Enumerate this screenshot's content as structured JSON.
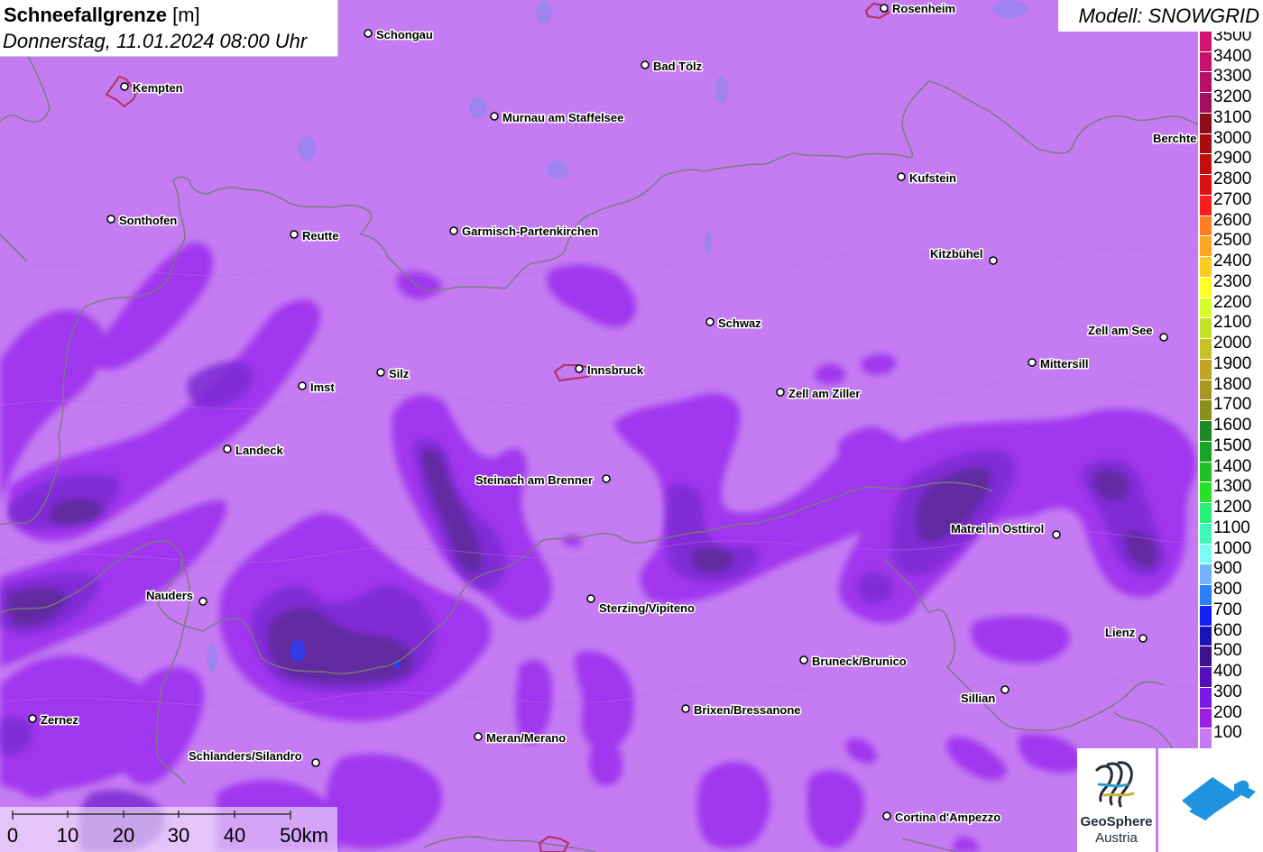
{
  "title": {
    "parameter": "Schneefallgrenze",
    "unit": "[m]",
    "datetime": "Donnerstag, 11.01.2024 08:00 Uhr"
  },
  "model_label": "Modell: SNOWGRID",
  "legend": {
    "unit": "m",
    "entries": [
      {
        "label": "3500",
        "color": "#d4156f"
      },
      {
        "label": "3400",
        "color": "#c8116a"
      },
      {
        "label": "3300",
        "color": "#b80e66"
      },
      {
        "label": "3200",
        "color": "#a30d5e"
      },
      {
        "label": "3100",
        "color": "#8e0a1d"
      },
      {
        "label": "3000",
        "color": "#a80b12"
      },
      {
        "label": "2900",
        "color": "#c20d0d"
      },
      {
        "label": "2800",
        "color": "#dd1010"
      },
      {
        "label": "2700",
        "color": "#ff1c1c"
      },
      {
        "label": "2600",
        "color": "#ff7f1f"
      },
      {
        "label": "2500",
        "color": "#ffa51f"
      },
      {
        "label": "2400",
        "color": "#ffcb1f"
      },
      {
        "label": "2300",
        "color": "#ffff25"
      },
      {
        "label": "2200",
        "color": "#d8ff25"
      },
      {
        "label": "2100",
        "color": "#c2e325"
      },
      {
        "label": "2000",
        "color": "#c7c325"
      },
      {
        "label": "1900",
        "color": "#c0a424"
      },
      {
        "label": "1800",
        "color": "#a79720"
      },
      {
        "label": "1700",
        "color": "#8a8f1c"
      },
      {
        "label": "1600",
        "color": "#1d8a2a"
      },
      {
        "label": "1500",
        "color": "#19a325"
      },
      {
        "label": "1400",
        "color": "#1fbf26"
      },
      {
        "label": "1300",
        "color": "#26e02c"
      },
      {
        "label": "1200",
        "color": "#25f07a"
      },
      {
        "label": "1100",
        "color": "#3ff8b9"
      },
      {
        "label": "1000",
        "color": "#7dfdf2"
      },
      {
        "label": "900",
        "color": "#6fb4f8"
      },
      {
        "label": "800",
        "color": "#2d7ef8"
      },
      {
        "label": "700",
        "color": "#1421f2"
      },
      {
        "label": "600",
        "color": "#1a14b5"
      },
      {
        "label": "500",
        "color": "#3c1291"
      },
      {
        "label": "400",
        "color": "#5410b8"
      },
      {
        "label": "300",
        "color": "#7a19e6"
      },
      {
        "label": "200",
        "color": "#9a1fe0"
      },
      {
        "label": "100",
        "color": "#c67af6"
      }
    ]
  },
  "scale_bar": {
    "labels": [
      "0",
      "10",
      "20",
      "30",
      "40",
      "50km"
    ]
  },
  "cities": [
    {
      "name": "Rosenheim"
    },
    {
      "name": "Schongau"
    },
    {
      "name": "Bad Tölz"
    },
    {
      "name": "Kempten"
    },
    {
      "name": "Murnau am Staffelsee"
    },
    {
      "name": "Berchte"
    },
    {
      "name": "Kufstein"
    },
    {
      "name": "Sonthofen"
    },
    {
      "name": "Reutte"
    },
    {
      "name": "Garmisch-Partenkirchen"
    },
    {
      "name": "Kitzbühel"
    },
    {
      "name": "Schwaz"
    },
    {
      "name": "Zell am See"
    },
    {
      "name": "Imst"
    },
    {
      "name": "Silz"
    },
    {
      "name": "Innsbruck"
    },
    {
      "name": "Mittersill"
    },
    {
      "name": "Zell am Ziller"
    },
    {
      "name": "Landeck"
    },
    {
      "name": "Steinach am Brenner"
    },
    {
      "name": "Matrei in Osttirol"
    },
    {
      "name": "Nauders"
    },
    {
      "name": "Sterzing/Vipiteno"
    },
    {
      "name": "Lienz"
    },
    {
      "name": "Bruneck/Brunico"
    },
    {
      "name": "Sillian"
    },
    {
      "name": "Brixen/Bressanone"
    },
    {
      "name": "Zernez"
    },
    {
      "name": "Meran/Merano"
    },
    {
      "name": "Schlanders/Silandro"
    },
    {
      "name": "Cortina d'Ampezzo"
    }
  ],
  "logos": {
    "geosphere_name": "GeoSphere",
    "geosphere_sub": "Austria"
  },
  "colors": {
    "background_100m": "#c57cf3",
    "band_200m": "#9d33ee",
    "band_300m": "#7b2bd2",
    "band_400m": "#5b2a98"
  }
}
